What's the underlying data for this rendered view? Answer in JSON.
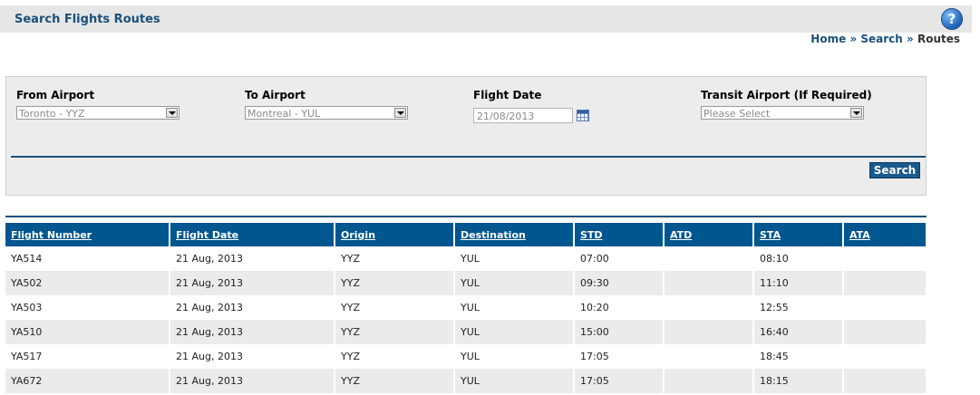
{
  "page": {
    "title": "Search Flights Routes"
  },
  "breadcrumb": {
    "home": "Home",
    "search": "Search",
    "current": "Routes",
    "sep": "»"
  },
  "filters": {
    "from": {
      "label": "From Airport",
      "value": "Toronto - YYZ"
    },
    "to": {
      "label": "To Airport",
      "value": "Montreal - YUL"
    },
    "date": {
      "label": "Flight Date",
      "value": "21/08/2013"
    },
    "transit": {
      "label": "Transit Airport (If Required)",
      "value": "Please Select"
    },
    "search_label": "Search"
  },
  "table": {
    "headers": [
      "Flight Number",
      "Flight Date",
      "Origin",
      "Destination",
      "STD",
      "ATD",
      "STA",
      "ATA"
    ],
    "rows": [
      [
        "YA514",
        "21 Aug, 2013",
        "YYZ",
        "YUL",
        "07:00",
        "",
        "08:10",
        ""
      ],
      [
        "YA502",
        "21 Aug, 2013",
        "YYZ",
        "YUL",
        "09:30",
        "",
        "11:10",
        ""
      ],
      [
        "YA503",
        "21 Aug, 2013",
        "YYZ",
        "YUL",
        "10:20",
        "",
        "12:55",
        ""
      ],
      [
        "YA510",
        "21 Aug, 2013",
        "YYZ",
        "YUL",
        "15:00",
        "",
        "16:40",
        ""
      ],
      [
        "YA517",
        "21 Aug, 2013",
        "YYZ",
        "YUL",
        "17:05",
        "",
        "18:45",
        ""
      ],
      [
        "YA672",
        "21 Aug, 2013",
        "YYZ",
        "YUL",
        "17:05",
        "",
        "18:15",
        ""
      ]
    ]
  },
  "icons": {
    "help": "help-icon",
    "calendar": "calendar-icon"
  },
  "colors": {
    "accent": "#00568f",
    "title": "#1a4f7a"
  }
}
